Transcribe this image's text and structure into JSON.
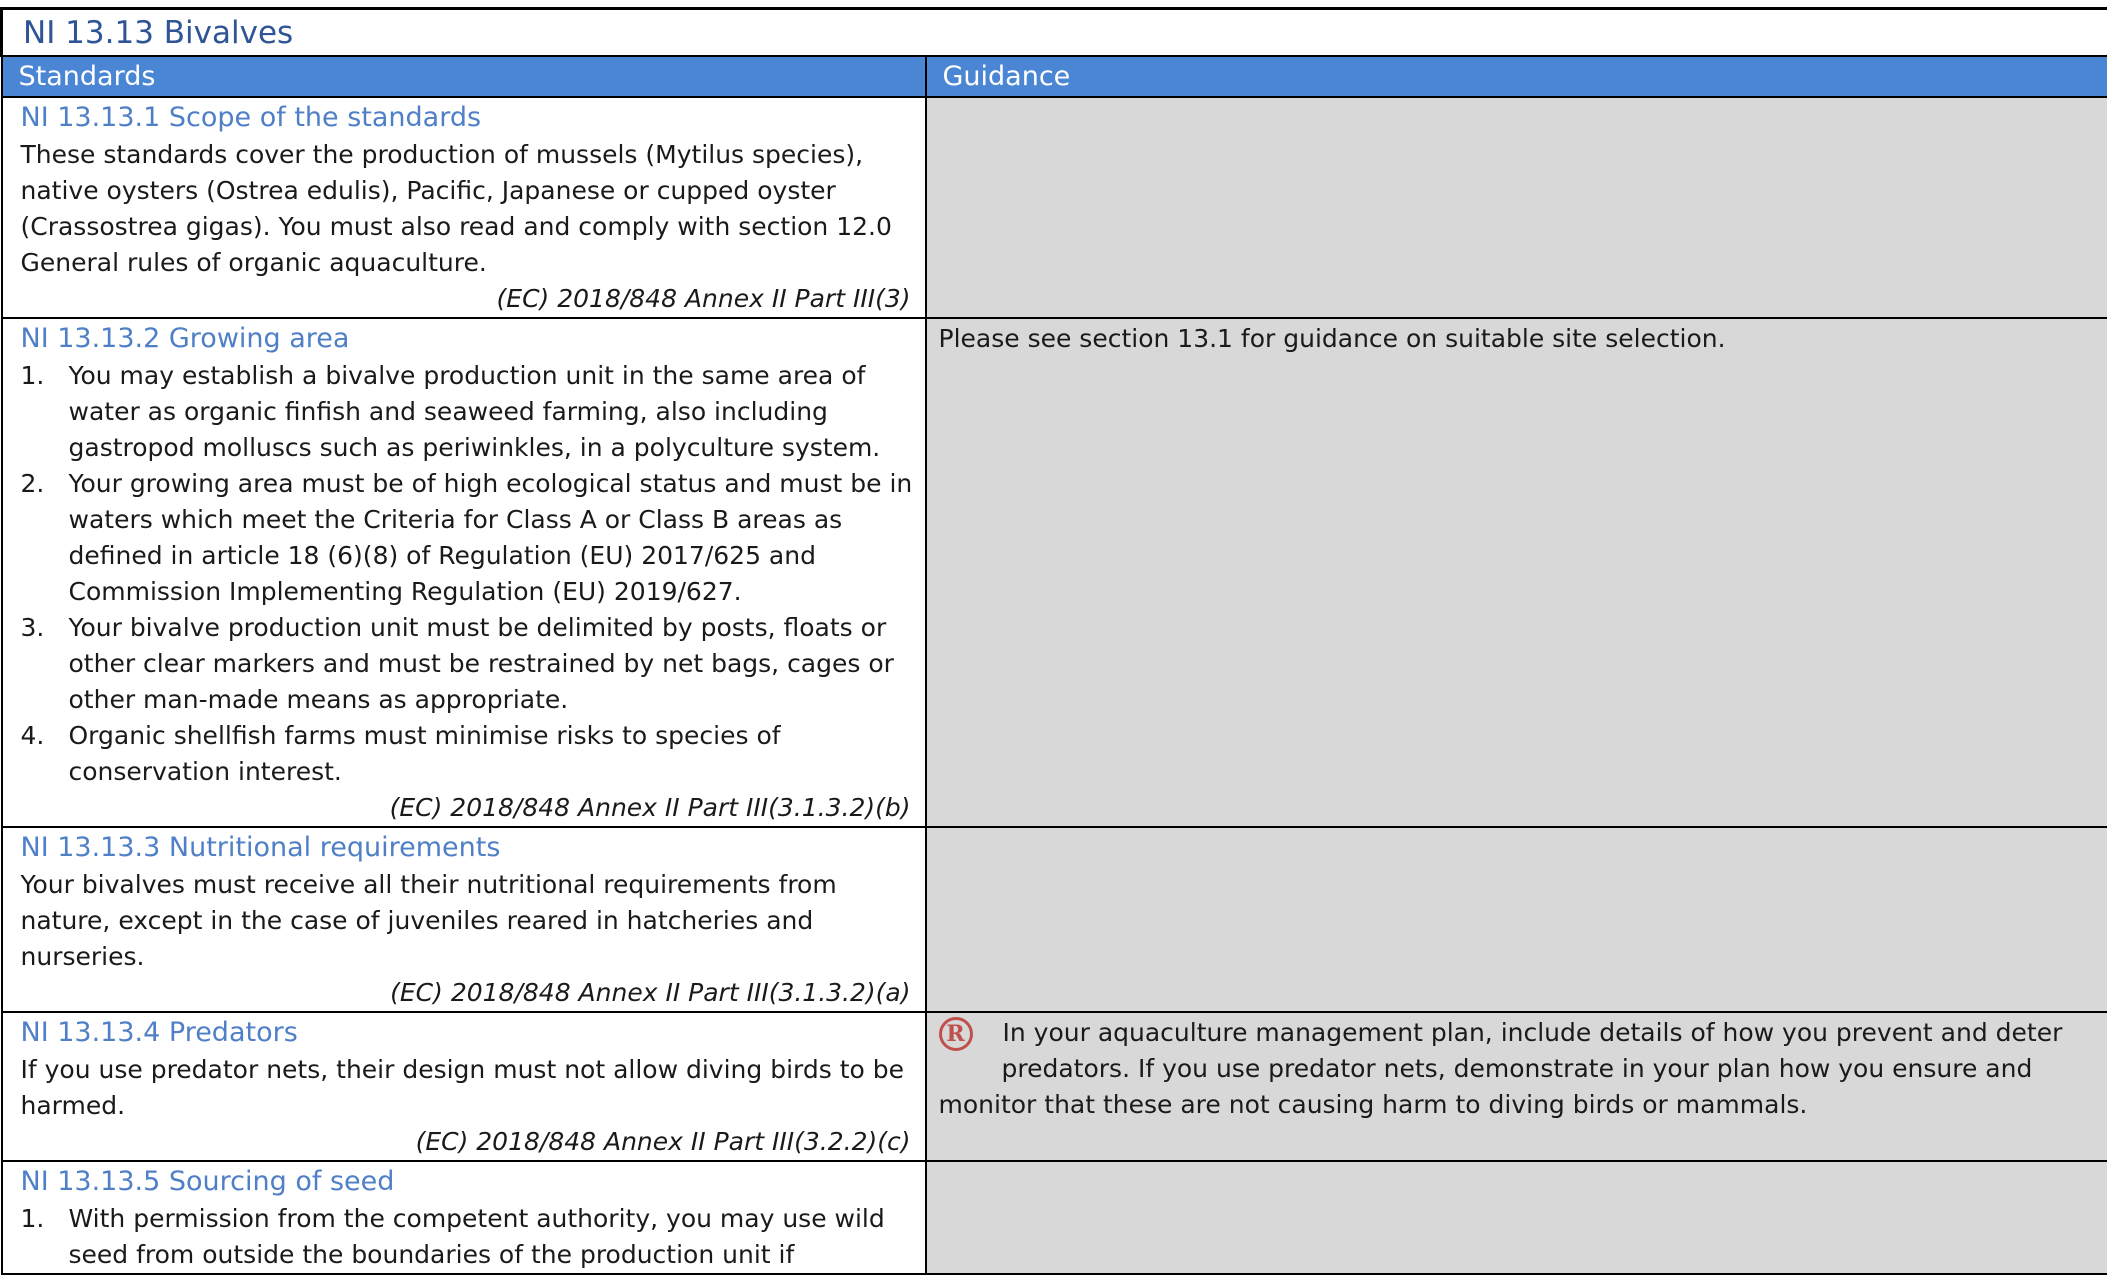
{
  "page_title": "NI 13.13 Bivalves",
  "header": {
    "standards": "Standards",
    "guidance": "Guidance"
  },
  "sections": [
    {
      "heading": "NI 13.13.1 Scope of the standards",
      "text": "These standards cover the production of mussels (Mytilus species), native oysters (Ostrea edulis), Pacific, Japanese or cupped oyster (Crassostrea gigas). You must also read and comply with section 12.0 General rules of organic aquaculture.",
      "ref": "(EC) 2018/848 Annex II Part III(3)",
      "guidance": ""
    },
    {
      "heading": "NI 13.13.2 Growing area",
      "items": [
        "You may establish a bivalve production unit in the same area of water as organic finfish and seaweed farming, also including gastropod molluscs such as periwinkles, in a polyculture system.",
        "Your growing area must be of high ecological status and must be in waters which meet the Criteria for Class A or Class B areas as defined in article 18 (6)(8) of Regulation (EU) 2017/625 and Commission Implementing Regulation (EU) 2019/627.",
        "Your bivalve production unit must be delimited by posts, floats or other clear markers and must be restrained by net bags, cages or other man-made means as appropriate.",
        "Organic shellfish farms must minimise risks to species of conservation interest."
      ],
      "ref": "(EC) 2018/848 Annex II Part III(3.1.3.2)(b)",
      "guidance": "Please see section 13.1 for guidance on suitable site selection."
    },
    {
      "heading": "NI 13.13.3 Nutritional requirements",
      "text": "Your bivalves must receive all their nutritional requirements from nature, except in the case of juveniles reared in hatcheries and nurseries.",
      "ref": "(EC) 2018/848 Annex II Part III(3.1.3.2)(a)",
      "guidance": ""
    },
    {
      "heading": "NI 13.13.4 Predators",
      "text": "If you use predator nets, their design must not allow diving birds to be harmed.",
      "ref": "(EC) 2018/848 Annex II Part III(3.2.2)(c)",
      "guidance_icon": "recommendation-r-icon",
      "guidance_icon_letter": "R",
      "guidance_icon_color": "#c0504d",
      "guidance_line1": "In your aquaculture management plan, include details of how you prevent and deter",
      "guidance_line2": "predators.  If you use predator nets, demonstrate in your plan how you ensure and",
      "guidance_line3": "monitor that these are not causing harm to diving birds or mammals."
    },
    {
      "heading": "NI 13.13.5 Sourcing of seed",
      "items": [
        "With permission from the competent authority, you may use wild seed from outside the boundaries of the production unit if"
      ],
      "guidance": ""
    }
  ],
  "colors": {
    "header_bg": "#4a86d4",
    "heading_text": "#4e7fc7",
    "title_text": "#2f5597",
    "guidance_bg": "#d8d8d8"
  }
}
